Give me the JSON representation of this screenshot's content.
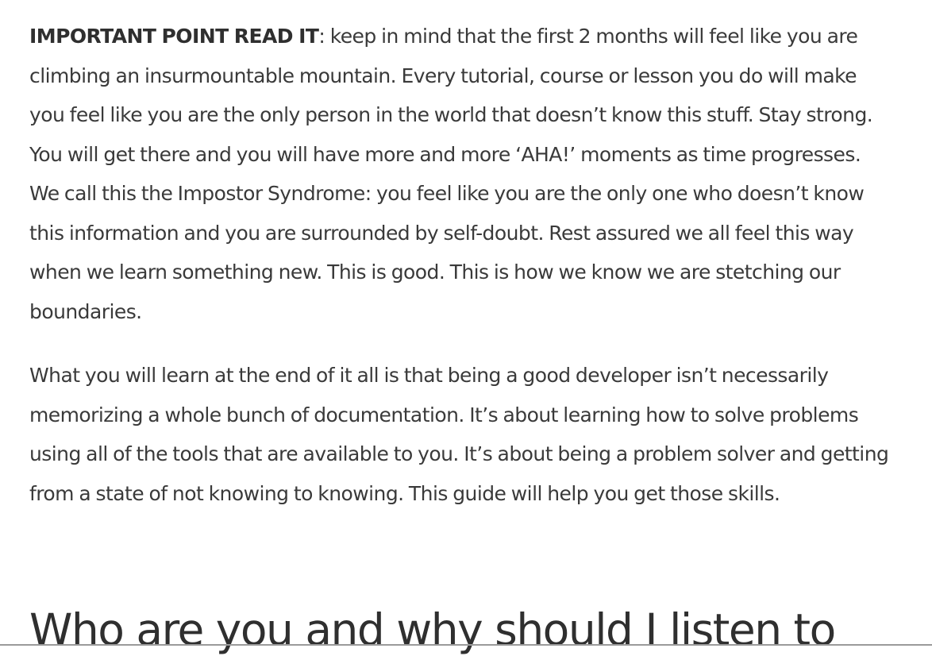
{
  "article": {
    "paragraph_1": {
      "lead": "IMPORTANT POINT READ IT",
      "text": ": keep in mind that the first 2 months will feel like you are climbing an insurmountable mountain. Every tutorial, course or lesson you do will make you feel like you are the only person in the world that doesn’t know this stuff. Stay strong. You will get there and you will have more and more ‘AHA!’ moments as time progresses. We call this the Impostor Syndrome: you feel like you are the only one who doesn’t know this information and you are surrounded by self-doubt. Rest assured we all feel this way when we learn something new. This is good. This is how we know we are stetching our boundaries."
    },
    "paragraph_2": "What you will learn at the end of it all is that being a good developer isn’t necessarily memorizing a whole bunch of documentation. It’s about learning how to solve problems using all of the tools that are available to you. It’s about being a problem solver and getting from a state of not knowing to knowing. This guide will help you get those skills.",
    "heading": "Who are you and why should I listen to"
  }
}
